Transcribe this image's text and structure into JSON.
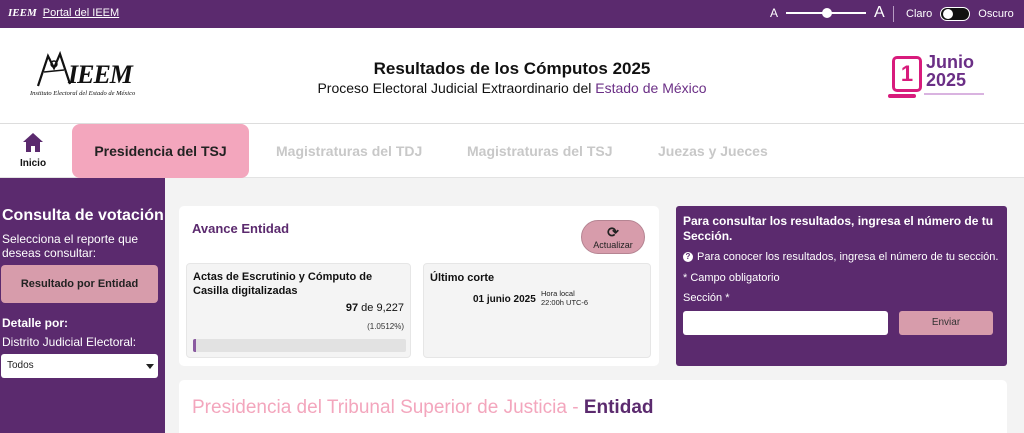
{
  "topbar": {
    "logo_text": "IEEM",
    "portal_link": "Portal del IEEM",
    "font_small": "A",
    "font_large": "A",
    "font_level": 0.45,
    "theme_light": "Claro",
    "theme_dark": "Oscuro"
  },
  "header": {
    "logo_word": "IEEM",
    "logo_tagline": "Instituto Electoral del Estado de México",
    "title": "Resultados de los Cómputos 2025",
    "subtitle_prefix": "Proceso Electoral Judicial Extraordinario del ",
    "subtitle_highlight": "Estado de México",
    "badge_day": "1",
    "badge_month": "Junio",
    "badge_year": "2025"
  },
  "nav": {
    "home_label": "Inicio",
    "tabs": [
      {
        "label": "Presidencia del TSJ",
        "active": true
      },
      {
        "label": "Magistraturas del TDJ",
        "active": false
      },
      {
        "label": "Magistraturas del TSJ",
        "active": false
      },
      {
        "label": "Juezas y Jueces",
        "active": false
      }
    ]
  },
  "sidebar": {
    "title": "Consulta de votación",
    "description": "Selecciona el reporte que deseas consultar:",
    "report_button": "Resultado por Entidad",
    "detail_title": "Detalle por:",
    "district_label": "Distrito Judicial Electoral:",
    "district_selected": "Todos"
  },
  "avance": {
    "title": "Avance Entidad",
    "refresh_label": "Actualizar",
    "actas_title": "Actas de Escrutinio y Cómputo de Casilla digitalizadas",
    "actas_count": "97",
    "actas_of": "de",
    "actas_total": "9,227",
    "actas_percent": "(1.0512%)",
    "actas_progress": 0.010512,
    "corte_title": "Último corte",
    "corte_date": "01 junio 2025",
    "corte_time_label": "Hora local",
    "corte_time": "22:00h UTC-6"
  },
  "consulta": {
    "heading": "Para consultar los resultados, ingresa el número de tu Sección.",
    "info": "Para conocer los resultados, ingresa el número de tu sección.",
    "required_note": "* Campo obligatorio",
    "section_label": "Sección *",
    "section_value": "",
    "submit_label": "Enviar"
  },
  "results": {
    "heading_main": "Presidencia del Tribunal Superior de Justicia",
    "heading_sep": " - ",
    "heading_scope": "Entidad"
  },
  "colors": {
    "brand_purple": "#5b2a6e",
    "accent_pink": "#f3a6bd",
    "button_rose": "#d79cab"
  }
}
